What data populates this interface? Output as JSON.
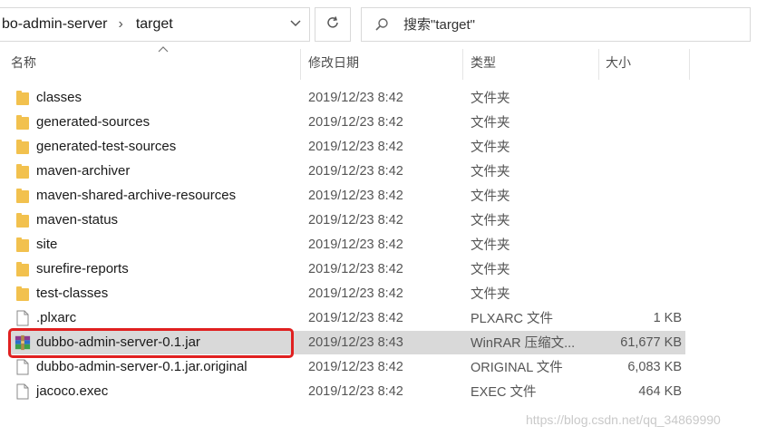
{
  "address_bar": {
    "crumbs": [
      "bo-admin-server",
      "target"
    ],
    "separator": "›"
  },
  "search": {
    "placeholder": "搜索\"target\""
  },
  "columns": {
    "name": "名称",
    "date": "修改日期",
    "type": "类型",
    "size": "大小"
  },
  "files": [
    {
      "name": "classes",
      "date": "2019/12/23 8:42",
      "type": "文件夹",
      "size": "",
      "icon": "folder-icon"
    },
    {
      "name": "generated-sources",
      "date": "2019/12/23 8:42",
      "type": "文件夹",
      "size": "",
      "icon": "folder-icon"
    },
    {
      "name": "generated-test-sources",
      "date": "2019/12/23 8:42",
      "type": "文件夹",
      "size": "",
      "icon": "folder-icon"
    },
    {
      "name": "maven-archiver",
      "date": "2019/12/23 8:42",
      "type": "文件夹",
      "size": "",
      "icon": "folder-icon"
    },
    {
      "name": "maven-shared-archive-resources",
      "date": "2019/12/23 8:42",
      "type": "文件夹",
      "size": "",
      "icon": "folder-icon"
    },
    {
      "name": "maven-status",
      "date": "2019/12/23 8:42",
      "type": "文件夹",
      "size": "",
      "icon": "folder-icon"
    },
    {
      "name": "site",
      "date": "2019/12/23 8:42",
      "type": "文件夹",
      "size": "",
      "icon": "folder-icon"
    },
    {
      "name": "surefire-reports",
      "date": "2019/12/23 8:42",
      "type": "文件夹",
      "size": "",
      "icon": "folder-icon"
    },
    {
      "name": "test-classes",
      "date": "2019/12/23 8:42",
      "type": "文件夹",
      "size": "",
      "icon": "folder-icon"
    },
    {
      "name": ".plxarc",
      "date": "2019/12/23 8:42",
      "type": "PLXARC 文件",
      "size": "1 KB",
      "icon": "file-icon"
    },
    {
      "name": "dubbo-admin-server-0.1.jar",
      "date": "2019/12/23 8:43",
      "type": "WinRAR 压缩文...",
      "size": "61,677 KB",
      "icon": "winrar-icon",
      "selected": true
    },
    {
      "name": "dubbo-admin-server-0.1.jar.original",
      "date": "2019/12/23 8:42",
      "type": "ORIGINAL 文件",
      "size": "6,083 KB",
      "icon": "file-icon"
    },
    {
      "name": "jacoco.exec",
      "date": "2019/12/23 8:42",
      "type": "EXEC 文件",
      "size": "464 KB",
      "icon": "file-icon"
    }
  ],
  "watermark": "https://blog.csdn.net/qq_34869990",
  "colors": {
    "folder": "#f2c14e",
    "highlight": "#e02020",
    "selected_bg": "#d9d9d9"
  }
}
